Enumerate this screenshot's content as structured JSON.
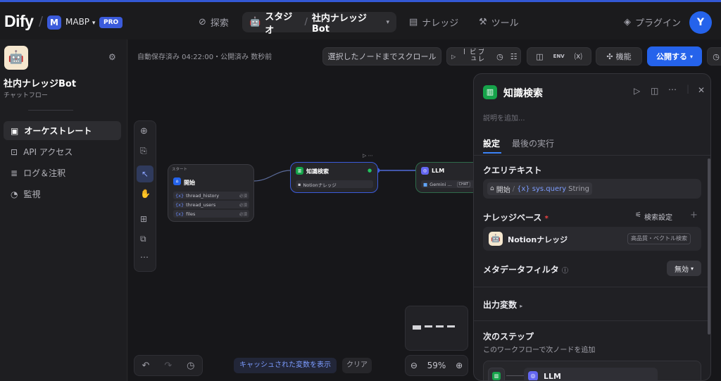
{
  "topbar": {
    "logo": "Dify",
    "workspace_initial": "M",
    "workspace_name": "MABP",
    "plan_badge": "PRO",
    "nav": {
      "explore": "探索",
      "studio": "スタジオ",
      "app_name": "社内ナレッジBot",
      "knowledge": "ナレッジ",
      "tools": "ツール",
      "plugins": "プラグイン"
    },
    "user_initial": "Y"
  },
  "sidebar": {
    "app_title": "社内ナレッジBot",
    "app_type": "チャットフロー",
    "items": [
      {
        "label": "オーケストレート",
        "active": true
      },
      {
        "label": "API アクセス",
        "active": false
      },
      {
        "label": "ログ＆注釈",
        "active": false
      },
      {
        "label": "監視",
        "active": false
      }
    ]
  },
  "canvas": {
    "autosave": "自動保存済み 04:22:00・公開済み 数秒前",
    "scroll_button": "選択したノードまでスクロール",
    "preview_label": "プレビュー",
    "env_label": "ENV",
    "features_button": "機能",
    "publish_button": "公開する",
    "cache_button": "キャッシュされた変数を表示",
    "clear_button": "クリア",
    "zoom": "59%"
  },
  "nodes": {
    "start": {
      "group_label": "スタート",
      "title": "開始",
      "vars": [
        {
          "name": "thread_history",
          "req": "必須"
        },
        {
          "name": "thread_users",
          "req": "必須"
        },
        {
          "name": "files",
          "req": "必須"
        }
      ]
    },
    "knowledge": {
      "title": "知識検索",
      "kb": "Notionナレッジ"
    },
    "llm": {
      "title": "LLM",
      "model": "Gemini ...",
      "mode": "CHAT"
    }
  },
  "panel": {
    "title": "知識検索",
    "description_placeholder": "説明を追加...",
    "tabs": [
      "設定",
      "最後の実行"
    ],
    "query_label": "クエリテキスト",
    "query_source": "開始",
    "query_var": "sys.query",
    "query_type": "String",
    "kb_label": "ナレッジベース",
    "required_mark": "*",
    "retrieval_settings": "検索設定",
    "kb_name": "Notionナレッジ",
    "kb_badge": "高品質・ベクトル検索",
    "metadata_label": "メタデータフィルタ",
    "metadata_value": "無効",
    "output_label": "出力変数",
    "next_step_label": "次のステップ",
    "next_step_desc": "このワークフローで次ノードを追加",
    "next_node": "LLM"
  },
  "colors": {
    "accent": "#2563eb",
    "knowledge_node": "#16a34a",
    "start_node": "#2563eb",
    "llm_node": "#6366f1"
  }
}
